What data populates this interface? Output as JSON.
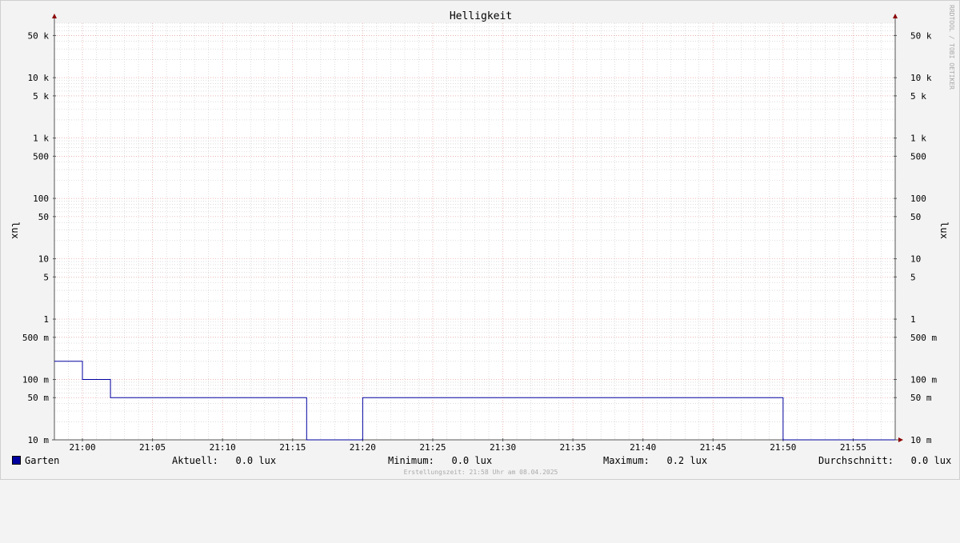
{
  "colors": {
    "background": "#f3f3f3",
    "canvas": "#ffffff",
    "major_grid": "#e8a0a0",
    "minor_grid": "#c8c8c8",
    "axis": "#555555",
    "arrow": "#8b0000",
    "series": "#0000a0"
  },
  "watermark": "RRDTOOL / TOBI OETIKER",
  "legend": {
    "series_name": "Garten",
    "current_label": "Aktuell:",
    "current_value": "0.0 lux",
    "min_label": "Minimum:",
    "min_value": "0.0 lux",
    "max_label": "Maximum:",
    "max_value": "0.2 lux",
    "avg_label": "Durchschnitt:",
    "avg_value": "0.0 lux"
  },
  "footer": "Erstellungszeit: 21:58 Uhr am 08.04.2025",
  "chart_data": {
    "type": "line",
    "title": "Helligkeit",
    "ylabel": "lux",
    "yscale": "log",
    "ylim": [
      0.01,
      80000
    ],
    "xlim": [
      "20:58",
      "21:58"
    ],
    "ytick_values": [
      0.01,
      0.05,
      0.1,
      0.5,
      1,
      5,
      10,
      50,
      100,
      500,
      1000,
      5000,
      10000,
      50000
    ],
    "ytick_labels": [
      "10 m",
      "50 m",
      "100 m",
      "500 m",
      "1",
      "5",
      "10",
      "50",
      "100",
      "500",
      "1 k",
      "5 k",
      "10 k",
      "50 k"
    ],
    "xtick_labels": [
      "21:00",
      "21:05",
      "21:10",
      "21:15",
      "21:20",
      "21:25",
      "21:30",
      "21:35",
      "21:40",
      "21:45",
      "21:50",
      "21:55"
    ],
    "grid": true,
    "legend_position": "bottom",
    "series": [
      {
        "name": "Garten",
        "step": true,
        "x": [
          "20:58",
          "21:00",
          "21:02",
          "21:04",
          "21:16",
          "21:20",
          "21:50",
          "21:58"
        ],
        "y": [
          0.2,
          0.1,
          0.05,
          0.05,
          0.01,
          0.05,
          0.01,
          0.01
        ]
      }
    ]
  }
}
